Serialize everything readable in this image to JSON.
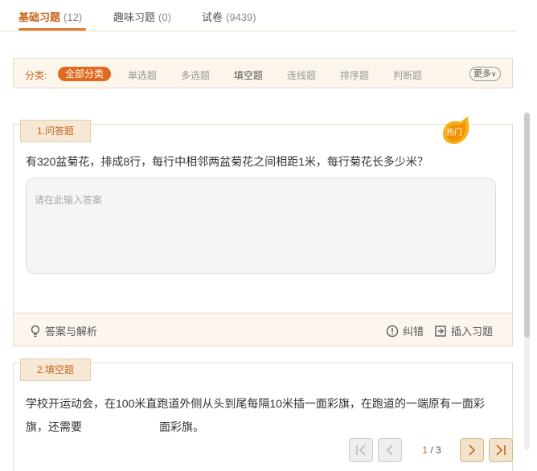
{
  "tabs": [
    {
      "label": "基础习题",
      "count": "(12)"
    },
    {
      "label": "趣味习题",
      "count": "(0)"
    },
    {
      "label": "试卷",
      "count": "(9439)"
    }
  ],
  "filter": {
    "label": "分类:",
    "items": [
      "全部分类",
      "单选题",
      "多选题",
      "填空题",
      "连线题",
      "排序题",
      "判断题"
    ],
    "more": "更多"
  },
  "cards": [
    {
      "badge": "1.问答题",
      "hot": "热门",
      "question": "有320盆菊花，排成8行，每行中相邻两盆菊花之间相距1米，每行菊花长多少米？",
      "answer_placeholder": "请在此输入答案",
      "footer": {
        "answer": "答案与解析",
        "report": "纠错",
        "insert": "插入习题"
      }
    },
    {
      "badge": "2.填空题",
      "question_part1": "学校开运动会，在100米直跑道外侧从头到尾每隔10米插一面彩旗，在跑道的一端原有一面彩旗，还需要",
      "question_part2": "面彩旗。"
    }
  ],
  "pager": {
    "current": "1",
    "separator": "/",
    "total": "3"
  },
  "colors": {
    "accent": "#e06a1e",
    "accent_text": "#c8641b",
    "panel_bg": "#fbf5ec"
  }
}
